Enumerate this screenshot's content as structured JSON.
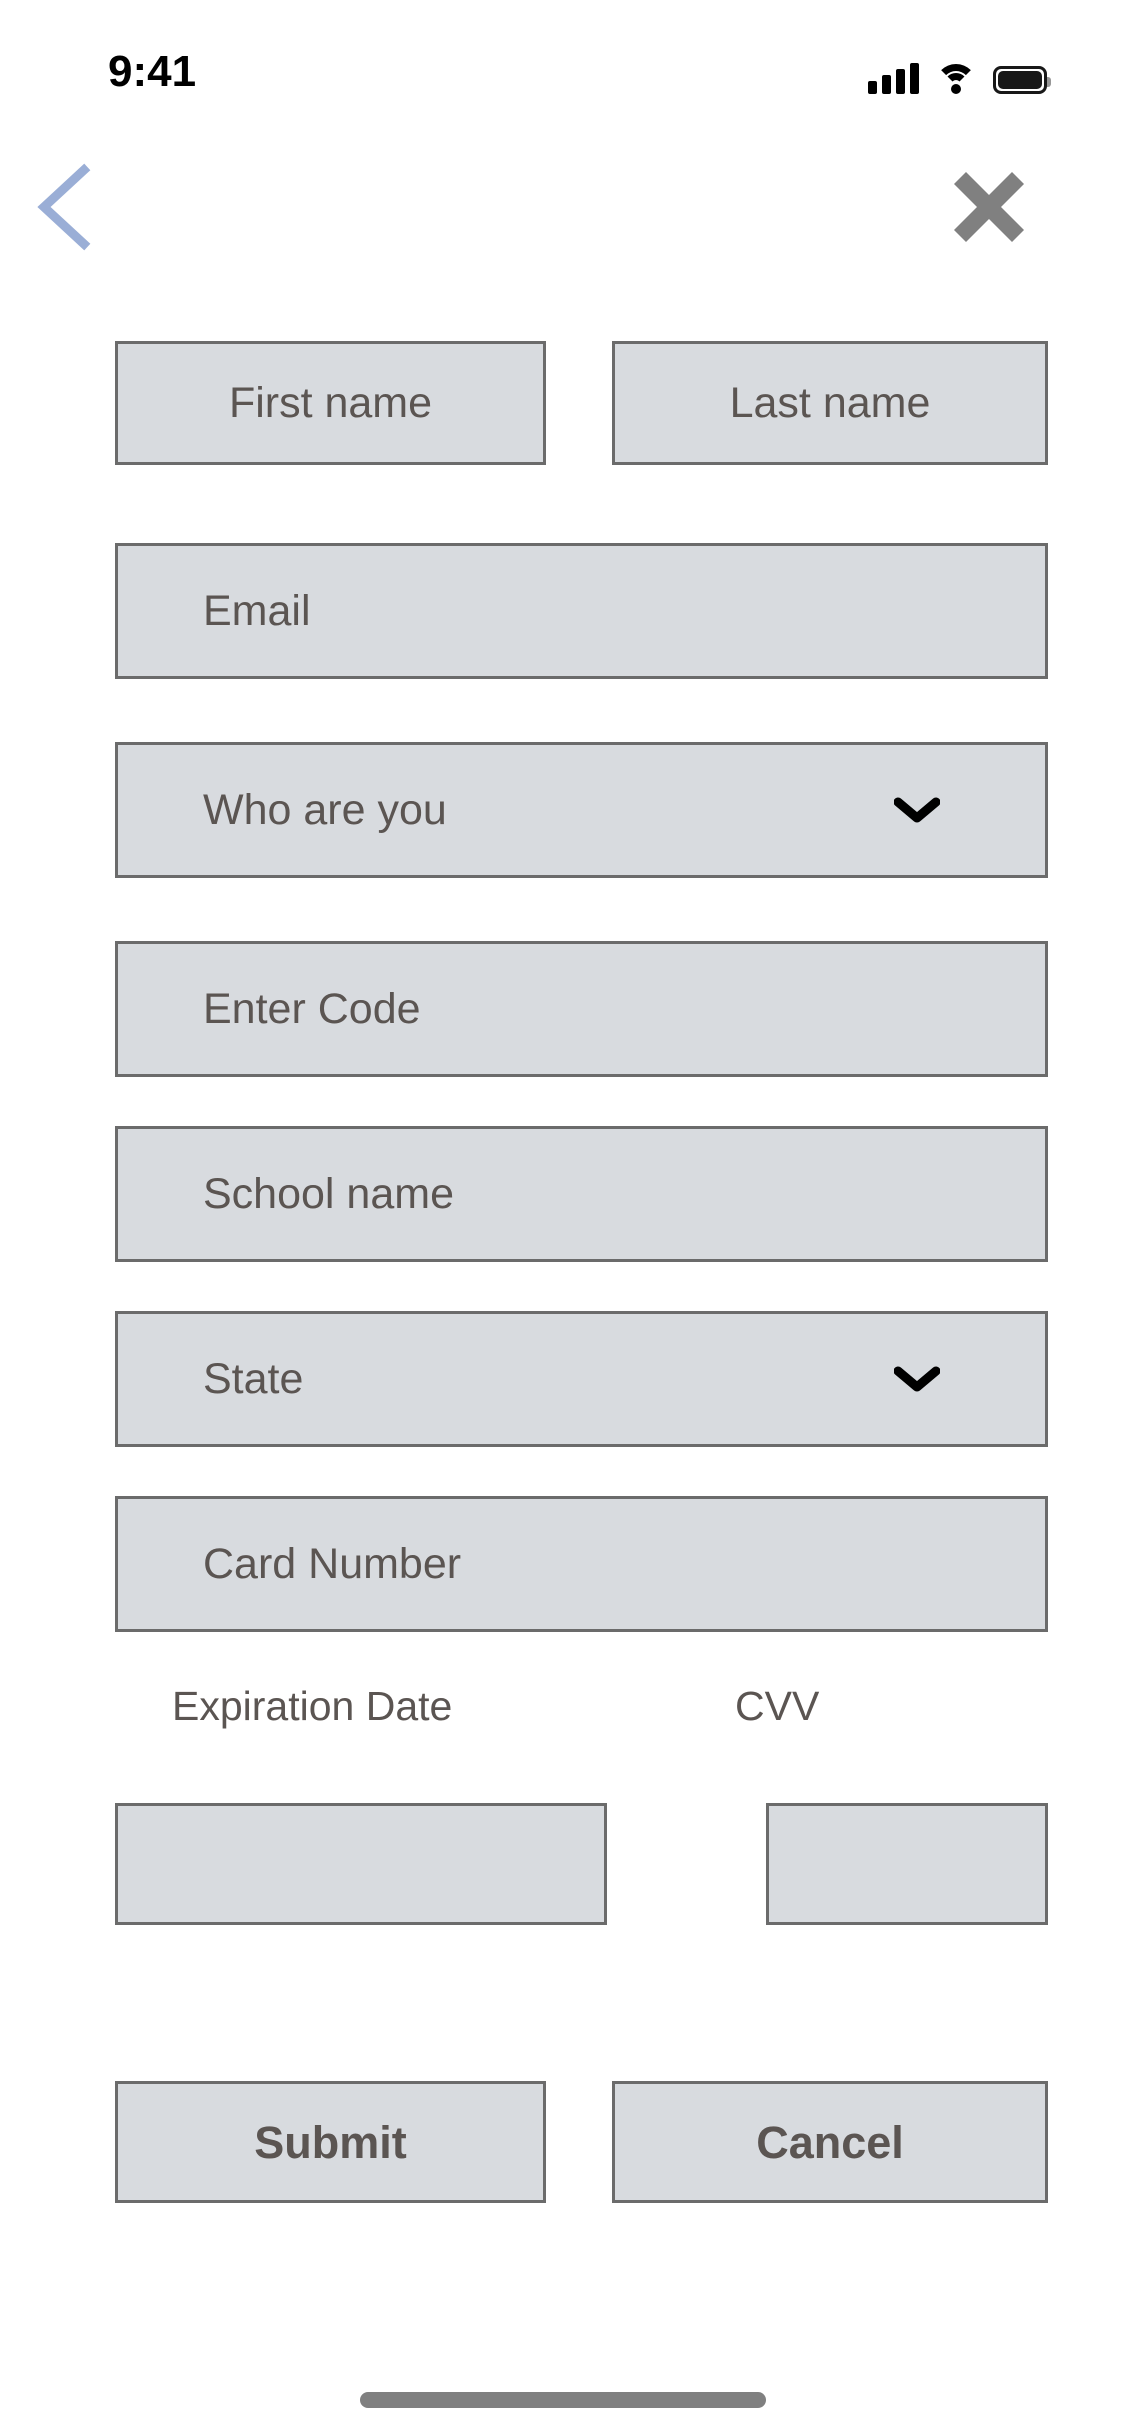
{
  "status_bar": {
    "time": "9:41",
    "cellular_icon": "cellular-bars-icon",
    "wifi_icon": "wifi-icon",
    "battery_icon": "battery-full-icon"
  },
  "nav": {
    "back_icon": "chevron-left-icon",
    "back_color": "#9aaed6",
    "close_icon": "close-x-icon",
    "close_color": "#808080"
  },
  "form": {
    "fields": [
      {
        "name": "first-name",
        "placeholder": "First name",
        "type": "text"
      },
      {
        "name": "last-name",
        "placeholder": "Last name",
        "type": "text"
      },
      {
        "name": "email",
        "placeholder": "Email",
        "type": "email"
      },
      {
        "name": "who-are-you",
        "placeholder": "Who are  you",
        "type": "select"
      },
      {
        "name": "enter-code",
        "placeholder": "Enter Code",
        "type": "text"
      },
      {
        "name": "school-name",
        "placeholder": "School name",
        "type": "text"
      },
      {
        "name": "state",
        "placeholder": "State",
        "type": "select"
      },
      {
        "name": "card-number",
        "placeholder": "Card Number",
        "type": "text"
      },
      {
        "name": "expiration-date",
        "placeholder": "",
        "type": "text",
        "label": "Expiration Date"
      },
      {
        "name": "cvv",
        "placeholder": "",
        "type": "text",
        "label": "CVV"
      }
    ],
    "first_name_placeholder": "First name",
    "last_name_placeholder": "Last name",
    "email_placeholder": "Email",
    "who_are_you_placeholder": "Who are  you",
    "enter_code_placeholder": "Enter Code",
    "school_name_placeholder": "School name",
    "state_placeholder": "State",
    "card_number_placeholder": "Card Number",
    "expiration_date_label": "Expiration Date",
    "cvv_label": "CVV",
    "expiration_date_value": "",
    "cvv_value": "",
    "dropdown_icon": "chevron-down-icon"
  },
  "actions": {
    "submit_label": "Submit",
    "cancel_label": "Cancel"
  },
  "theme": {
    "field_fill": "#d8dbdf",
    "field_border": "#6b6b6b",
    "text_color": "#5b5552",
    "background": "#ffffff",
    "home_indicator": "#808080"
  }
}
